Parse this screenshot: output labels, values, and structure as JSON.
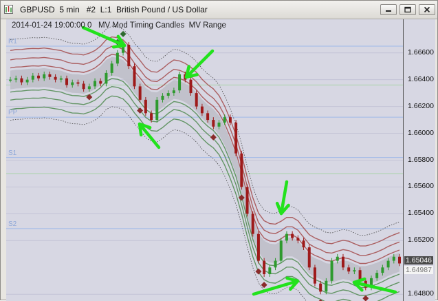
{
  "window": {
    "title": "GBPUSD  5 min   #2  L:1  British Pound / US Dollar"
  },
  "chart_header": "2014-01-24 19:00:00 0   MV Mod Timing Candles  MV Range",
  "pivot_labels": [
    "R1",
    "PP",
    "S1",
    "S2"
  ],
  "price_axis": {
    "labels": [
      "1.66600",
      "1.66400",
      "1.66200",
      "1.66000",
      "1.65800",
      "1.65600",
      "1.65400",
      "1.65200",
      "1.64800"
    ],
    "bid_tag": "1.65046",
    "ask_tag": "1.64987"
  },
  "colors": {
    "chart_bg": "#d7d7e3",
    "bull": "#2e9a2e",
    "bear": "#9e1a1a",
    "diamond_bear": "#8a2b2b",
    "diamond_bull": "#2f6b2f",
    "band_red": "#a34a4a",
    "band_green": "#4f8a4f",
    "pivot_line": "#9fb9e8",
    "arrow": "#22e21c"
  },
  "chart_data": {
    "type": "candlestick",
    "symbol": "GBPUSD",
    "timeframe": "5 min",
    "ylim": [
      1.6475,
      1.6685
    ],
    "pivots": {
      "R1": 1.6665,
      "PP": 1.6612,
      "S1": 1.6582,
      "S2": 1.6529
    },
    "series": [
      {
        "name": "close",
        "values": [
          1.664,
          1.6641,
          1.6638,
          1.664,
          1.6643,
          1.6641,
          1.6644,
          1.6642,
          1.664,
          1.6641,
          1.6636,
          1.6638,
          1.6637,
          1.6633,
          1.6635,
          1.6639,
          1.6637,
          1.6645,
          1.6652,
          1.666,
          1.6666,
          1.665,
          1.6635,
          1.6625,
          1.6615,
          1.661,
          1.6625,
          1.6628,
          1.663,
          1.6632,
          1.6644,
          1.664,
          1.663,
          1.662,
          1.6615,
          1.661,
          1.6605,
          1.6608,
          1.6612,
          1.6608,
          1.6585,
          1.656,
          1.654,
          1.6525,
          1.6505,
          1.6495,
          1.65,
          1.6505,
          1.652,
          1.6525,
          1.6522,
          1.652,
          1.6515,
          1.65,
          1.6488,
          1.6482,
          1.649,
          1.6505,
          1.6508,
          1.65,
          1.6497,
          1.6498,
          1.649,
          1.6485,
          1.6492,
          1.6496,
          1.65,
          1.6505,
          1.6508,
          1.6503
        ]
      }
    ]
  }
}
